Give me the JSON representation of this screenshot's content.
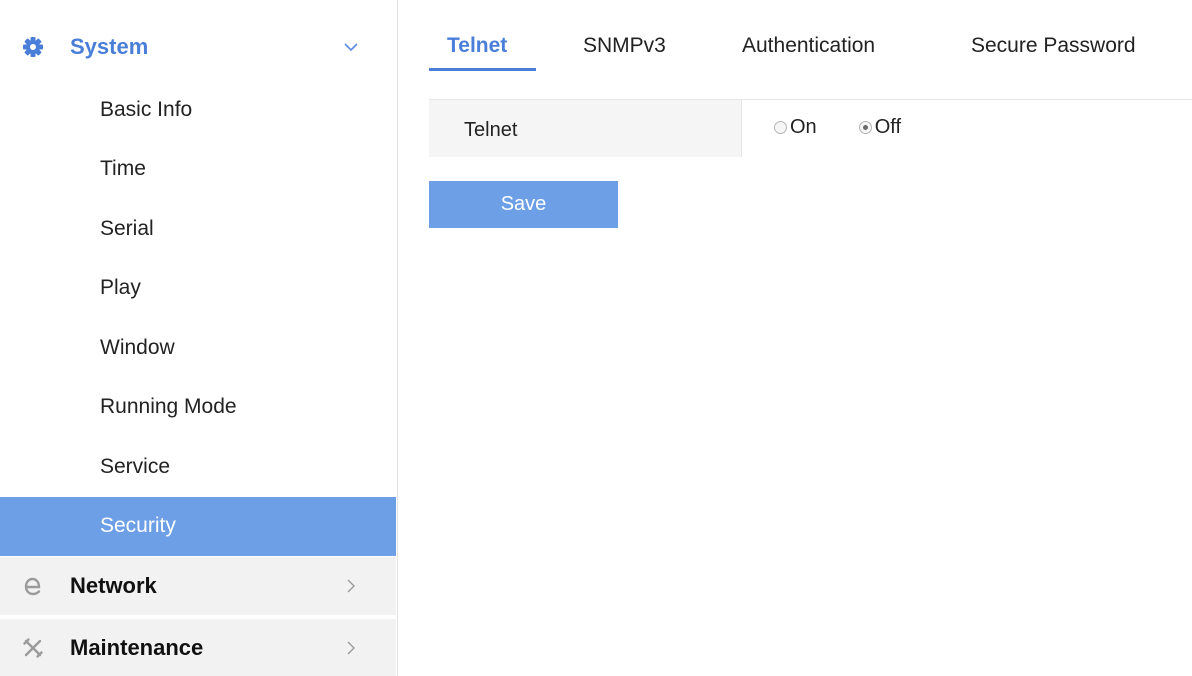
{
  "sidebar": {
    "system": {
      "label": "System",
      "icon": "gear-icon",
      "expanded": true,
      "items": [
        {
          "label": "Basic Info",
          "active": false
        },
        {
          "label": "Time",
          "active": false
        },
        {
          "label": "Serial",
          "active": false
        },
        {
          "label": "Play",
          "active": false
        },
        {
          "label": "Window",
          "active": false
        },
        {
          "label": "Running Mode",
          "active": false
        },
        {
          "label": "Service",
          "active": false
        },
        {
          "label": "Security",
          "active": true
        }
      ]
    },
    "network": {
      "label": "Network",
      "icon": "network-e-icon",
      "expanded": false
    },
    "maintenance": {
      "label": "Maintenance",
      "icon": "tools-icon",
      "expanded": false
    }
  },
  "tabs": [
    {
      "label": "Telnet",
      "active": true
    },
    {
      "label": "SNMPv3",
      "active": false
    },
    {
      "label": "Authentication",
      "active": false
    },
    {
      "label": "Secure Password",
      "active": false
    }
  ],
  "form": {
    "telnet_label": "Telnet",
    "options": [
      {
        "label": "On",
        "checked": false
      },
      {
        "label": "Off",
        "checked": true
      }
    ]
  },
  "actions": {
    "save_label": "Save"
  },
  "colors": {
    "accent": "#4a7fd9",
    "active_bg": "#6d9fe6",
    "collapsed_group_bg": "#f2f2f2",
    "label_cell_bg": "#f5f5f5"
  }
}
